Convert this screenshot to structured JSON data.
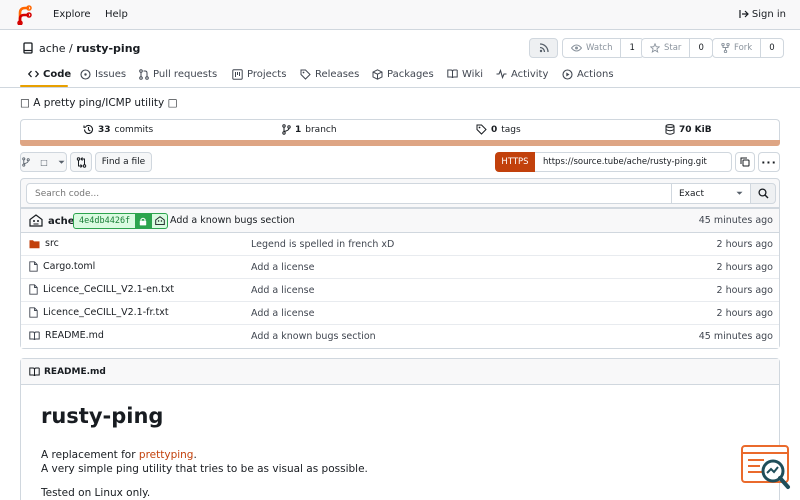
{
  "nav": {
    "explore": "Explore",
    "help": "Help",
    "sign_in": "Sign in"
  },
  "repo": {
    "owner": "ache",
    "separator": "/",
    "name": "rusty-ping",
    "watch_label": "Watch",
    "watch_count": "1",
    "star_label": "Star",
    "star_count": "0",
    "fork_label": "Fork",
    "fork_count": "0",
    "description": "A pretty ping/ICMP utility"
  },
  "tabs": [
    {
      "label": "Code",
      "icon": "code-icon"
    },
    {
      "label": "Issues",
      "icon": "issue-icon"
    },
    {
      "label": "Pull requests",
      "icon": "pull-request-icon"
    },
    {
      "label": "Projects",
      "icon": "project-icon"
    },
    {
      "label": "Releases",
      "icon": "tag-icon"
    },
    {
      "label": "Packages",
      "icon": "package-icon"
    },
    {
      "label": "Wiki",
      "icon": "book-icon"
    },
    {
      "label": "Activity",
      "icon": "pulse-icon"
    },
    {
      "label": "Actions",
      "icon": "play-icon"
    }
  ],
  "stats": {
    "commits_count": "33",
    "commits_label": "commits",
    "branch_count": "1",
    "branch_label": "branch",
    "tags_count": "0",
    "tags_label": "tags",
    "size": "70 KiB"
  },
  "toolbar": {
    "find_file": "Find a file",
    "protocol": "HTTPS",
    "clone_url": "https://source.tube/ache/rusty-ping.git"
  },
  "search": {
    "placeholder": "Search code...",
    "mode": "Exact"
  },
  "latest_commit": {
    "author": "ache",
    "sha": "4e4db4426f",
    "message": "Add a known bugs section",
    "time": "45 minutes ago"
  },
  "files": [
    {
      "name": "src",
      "type": "dir",
      "message": "Legend is spelled in french xD",
      "time": "2 hours ago"
    },
    {
      "name": "Cargo.toml",
      "type": "file",
      "message": "Add a license",
      "time": "2 hours ago"
    },
    {
      "name": "Licence_CeCILL_V2.1-en.txt",
      "type": "file",
      "message": "Add a license",
      "time": "2 hours ago"
    },
    {
      "name": "Licence_CeCILL_V2.1-fr.txt",
      "type": "file",
      "message": "Add a license",
      "time": "2 hours ago"
    },
    {
      "name": "README.md",
      "type": "file",
      "message": "Add a known bugs section",
      "time": "45 minutes ago"
    }
  ],
  "readme": {
    "filename": "README.md",
    "title": "rusty-ping",
    "intro": "A replacement for",
    "link": "prettyping",
    "intro_end": ".",
    "line2": "A very simple ping utility that tries to be as visual as possible.",
    "line3": "Tested on Linux only."
  },
  "colors": {
    "accent": "#c2410c",
    "tab_underline": "#e8a000",
    "lang_rust": "#dea584",
    "folder": "#c2410c"
  }
}
